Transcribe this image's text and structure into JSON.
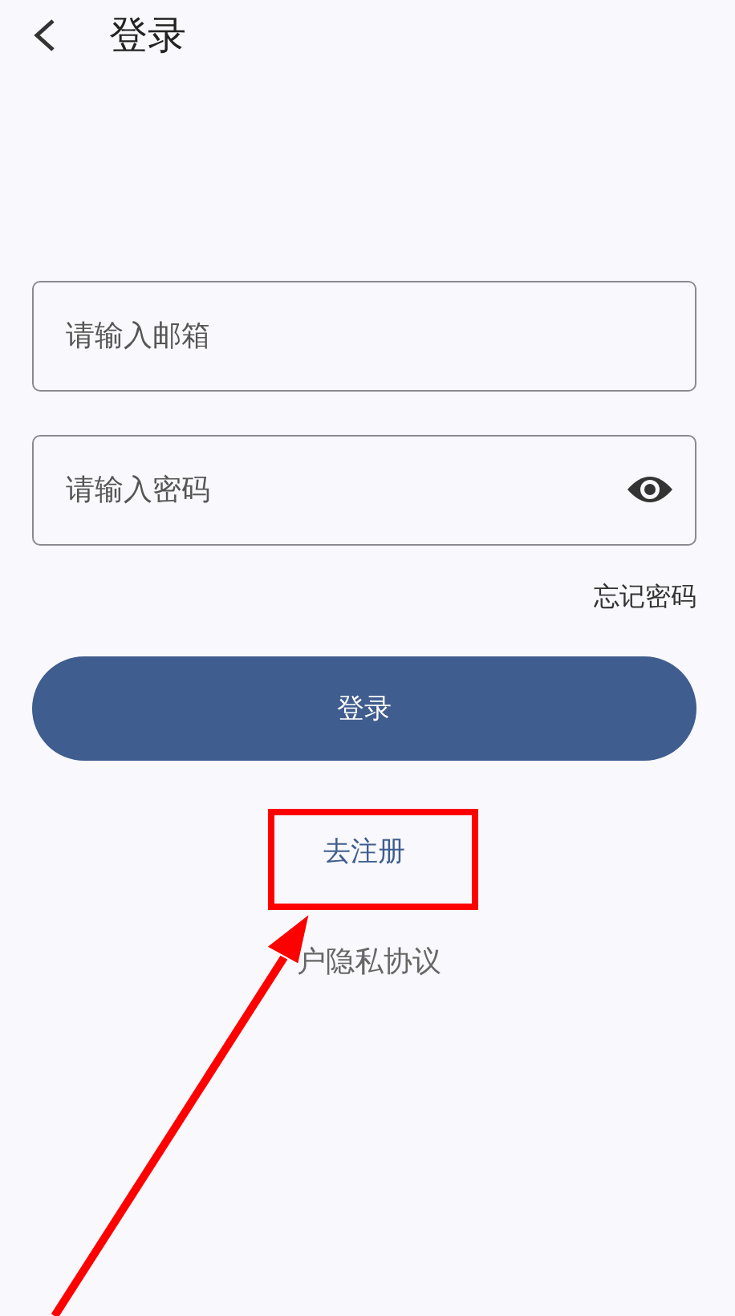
{
  "header": {
    "title": "登录"
  },
  "fields": [
    {
      "placeholder": "请输入邮箱",
      "kind": "text"
    },
    {
      "placeholder": "请输入密码",
      "kind": "password"
    }
  ],
  "forgot_link": "忘记密码",
  "login_button": "登录",
  "register_link": "去注册",
  "privacy_link": "户隐私协议"
}
